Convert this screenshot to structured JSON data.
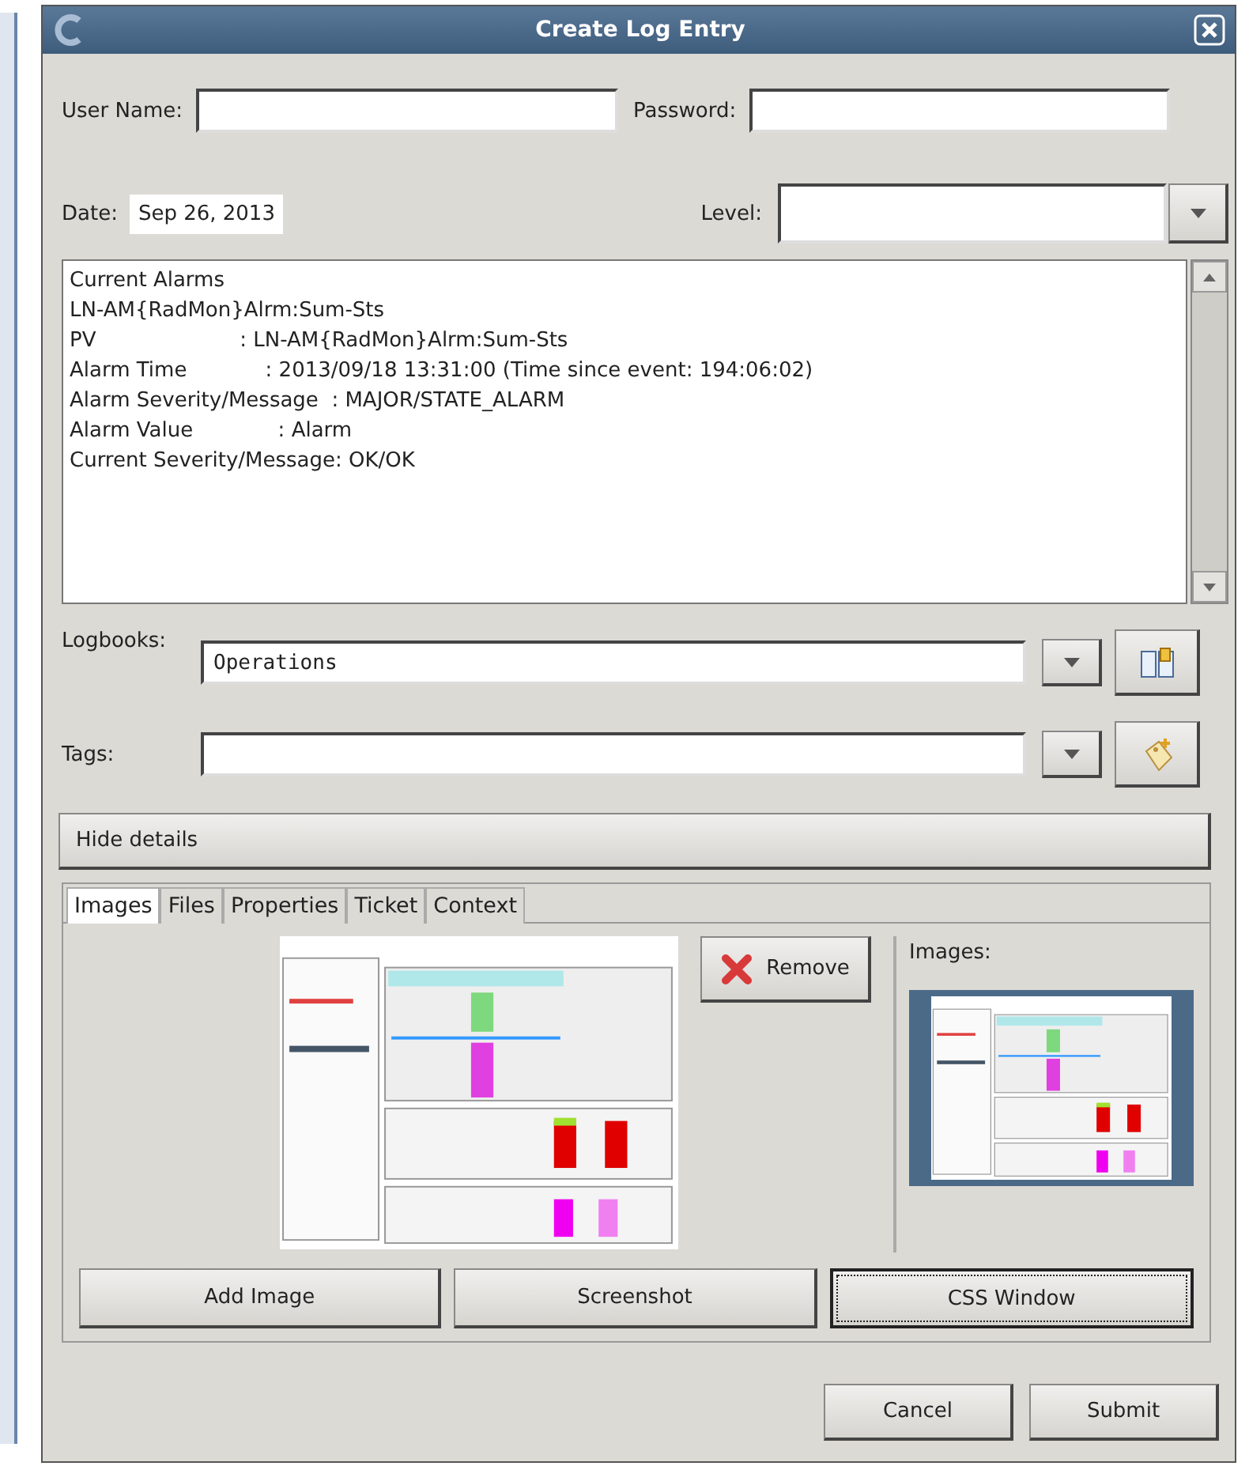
{
  "window": {
    "title": "Create Log Entry"
  },
  "credentials": {
    "user_label": "User Name:",
    "password_label": "Password:"
  },
  "date": {
    "label": "Date:",
    "value": "Sep 26, 2013"
  },
  "level": {
    "label": "Level:"
  },
  "description": {
    "lines": [
      "Current Alarms",
      "LN-AM{RadMon}Alrm:Sum-Sts",
      "PV                      : LN-AM{RadMon}Alrm:Sum-Sts",
      "Alarm Time            : 2013/09/18 13:31:00 (Time since event: 194:06:02)",
      "Alarm Severity/Message  : MAJOR/STATE_ALARM",
      "Alarm Value             : Alarm",
      "Current Severity/Message: OK/OK"
    ]
  },
  "logbooks": {
    "label": "Logbooks:",
    "value": "Operations"
  },
  "tags": {
    "label": "Tags:"
  },
  "details_button": "Hide details",
  "tabs": [
    {
      "label": "Images",
      "selected": true
    },
    {
      "label": "Files",
      "selected": false
    },
    {
      "label": "Properties",
      "selected": false
    },
    {
      "label": "Ticket",
      "selected": false
    },
    {
      "label": "Context",
      "selected": false
    }
  ],
  "images": {
    "remove_button": "Remove",
    "list_label": "Images:",
    "buttons": [
      {
        "label": "Add Image",
        "focused": false
      },
      {
        "label": "Screenshot",
        "focused": false
      },
      {
        "label": "CSS Window",
        "focused": true
      }
    ]
  },
  "footer": {
    "buttons": [
      "Cancel",
      "Submit"
    ]
  }
}
